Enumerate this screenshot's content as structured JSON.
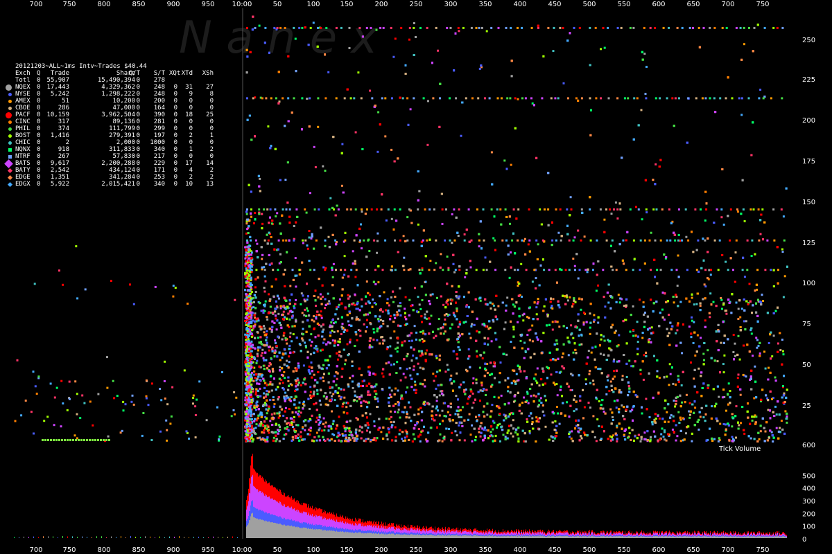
{
  "watermark": "N   a   n   e   x",
  "chart_data": {
    "type": "scatter",
    "title": "20121203~ALL~1ms Intv~Trades $40.44",
    "x_ticks": [
      "700",
      "750",
      "800",
      "850",
      "900",
      "950",
      "10:00",
      "50",
      "100",
      "150",
      "200",
      "250",
      "300",
      "350",
      "400",
      "450",
      "500",
      "550",
      "600",
      "650",
      "700",
      "750"
    ],
    "y_ticks": [
      "250",
      "225",
      "200",
      "175",
      "150",
      "125",
      "100",
      "75",
      "50",
      "25",
      "600"
    ],
    "volume_ticks": [
      "500",
      "400",
      "300",
      "200",
      "100",
      "0"
    ],
    "volume_label": "Tick Volume",
    "ylim": [
      0,
      270
    ],
    "volume_ylim": [
      0,
      600
    ],
    "legend": {
      "headers": [
        "Exch",
        "Q",
        "Trade",
        "Share",
        "Q/T",
        "S/T",
        "XQt",
        "XTd",
        "XSh"
      ],
      "rows": [
        {
          "exch": "Totl",
          "q": "0",
          "trade": "55,907",
          "share": "15,490,394",
          "qt": "0",
          "st": "278",
          "xqt": "",
          "xtd": "",
          "xsh": "",
          "color": "",
          "shape": "none"
        },
        {
          "exch": "NQEX",
          "q": "0",
          "trade": "17,443",
          "share": "4,329,362",
          "qt": "0",
          "st": "248",
          "xqt": "0",
          "xtd": "31",
          "xsh": "27",
          "color": "#a0a0a0",
          "shape": "circle-big"
        },
        {
          "exch": "NYSE",
          "q": "0",
          "trade": "5,242",
          "share": "1,298,222",
          "qt": "0",
          "st": "248",
          "xqt": "0",
          "xtd": "9",
          "xsh": "8",
          "color": "#4a5cff",
          "shape": "circle"
        },
        {
          "exch": "AMEX",
          "q": "0",
          "trade": "51",
          "share": "10,200",
          "qt": "0",
          "st": "200",
          "xqt": "0",
          "xtd": "0",
          "xsh": "0",
          "color": "#ff9900",
          "shape": "circle"
        },
        {
          "exch": "CBOE",
          "q": "0",
          "trade": "286",
          "share": "47,000",
          "qt": "0",
          "st": "164",
          "xqt": "0",
          "xtd": "0",
          "xsh": "0",
          "color": "#d4b080",
          "shape": "circle"
        },
        {
          "exch": "PACF",
          "q": "0",
          "trade": "10,159",
          "share": "3,962,504",
          "qt": "0",
          "st": "390",
          "xqt": "0",
          "xtd": "18",
          "xsh": "25",
          "color": "#ff0000",
          "shape": "circle-big"
        },
        {
          "exch": "CINC",
          "q": "0",
          "trade": "317",
          "share": "89,136",
          "qt": "0",
          "st": "281",
          "xqt": "0",
          "xtd": "0",
          "xsh": "0",
          "color": "#ff7f00",
          "shape": "circle"
        },
        {
          "exch": "PHIL",
          "q": "0",
          "trade": "374",
          "share": "111,799",
          "qt": "0",
          "st": "299",
          "xqt": "0",
          "xtd": "0",
          "xsh": "0",
          "color": "#44dd44",
          "shape": "circle"
        },
        {
          "exch": "BOST",
          "q": "0",
          "trade": "1,416",
          "share": "279,391",
          "qt": "0",
          "st": "197",
          "xqt": "0",
          "xtd": "2",
          "xsh": "1",
          "color": "#a0ff00",
          "shape": "circle"
        },
        {
          "exch": "CHIC",
          "q": "0",
          "trade": "2",
          "share": "2,000",
          "qt": "0",
          "st": "1000",
          "xqt": "0",
          "xtd": "0",
          "xsh": "0",
          "color": "#40c0c0",
          "shape": "circle"
        },
        {
          "exch": "NQNX",
          "q": "0",
          "trade": "918",
          "share": "311,833",
          "qt": "0",
          "st": "340",
          "xqt": "0",
          "xtd": "1",
          "xsh": "2",
          "color": "#00ff66",
          "shape": "square"
        },
        {
          "exch": "NTRF",
          "q": "0",
          "trade": "267",
          "share": "57,830",
          "qt": "0",
          "st": "217",
          "xqt": "0",
          "xtd": "0",
          "xsh": "0",
          "color": "#70a0ff",
          "shape": "square"
        },
        {
          "exch": "BATS",
          "q": "0",
          "trade": "9,617",
          "share": "2,200,288",
          "qt": "0",
          "st": "229",
          "xqt": "0",
          "xtd": "17",
          "xsh": "14",
          "color": "#cc44ff",
          "shape": "diamond-big"
        },
        {
          "exch": "BATY",
          "q": "0",
          "trade": "2,542",
          "share": "434,124",
          "qt": "0",
          "st": "171",
          "xqt": "0",
          "xtd": "4",
          "xsh": "2",
          "color": "#ff3366",
          "shape": "diamond"
        },
        {
          "exch": "EDGE",
          "q": "0",
          "trade": "1,351",
          "share": "341,284",
          "qt": "0",
          "st": "253",
          "xqt": "0",
          "xtd": "2",
          "xsh": "2",
          "color": "#ff8844",
          "shape": "diamond"
        },
        {
          "exch": "EDGX",
          "q": "0",
          "trade": "5,922",
          "share": "2,015,421",
          "qt": "0",
          "st": "340",
          "xqt": "0",
          "xtd": "10",
          "xsh": "13",
          "color": "#44aaff",
          "shape": "diamond"
        }
      ]
    }
  }
}
